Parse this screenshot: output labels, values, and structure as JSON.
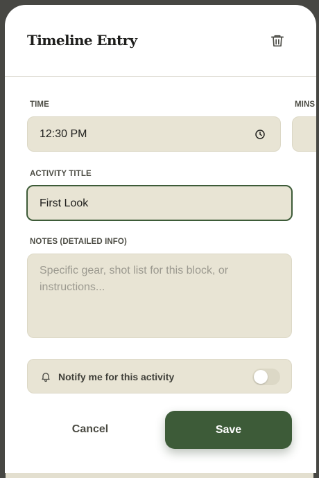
{
  "modal": {
    "title": "Timeline Entry"
  },
  "time": {
    "label": "TIME",
    "value": "12:30 PM"
  },
  "mins": {
    "label": "MINS"
  },
  "activity": {
    "label": "ACTIVITY TITLE",
    "value": "First Look"
  },
  "notes": {
    "label": "NOTES (DETAILED INFO)",
    "placeholder": "Specific gear, shot list for this block, or instructions..."
  },
  "notify": {
    "label": "Notify me for this activity",
    "enabled": false
  },
  "actions": {
    "cancel_label": "Cancel",
    "save_label": "Save"
  },
  "colors": {
    "primary": "#3d5b38",
    "field_bg": "#e8e4d4",
    "active_border": "#3d5b38"
  },
  "icons": {
    "delete": "trash-icon",
    "time": "clock-icon",
    "notify": "bell-icon"
  }
}
